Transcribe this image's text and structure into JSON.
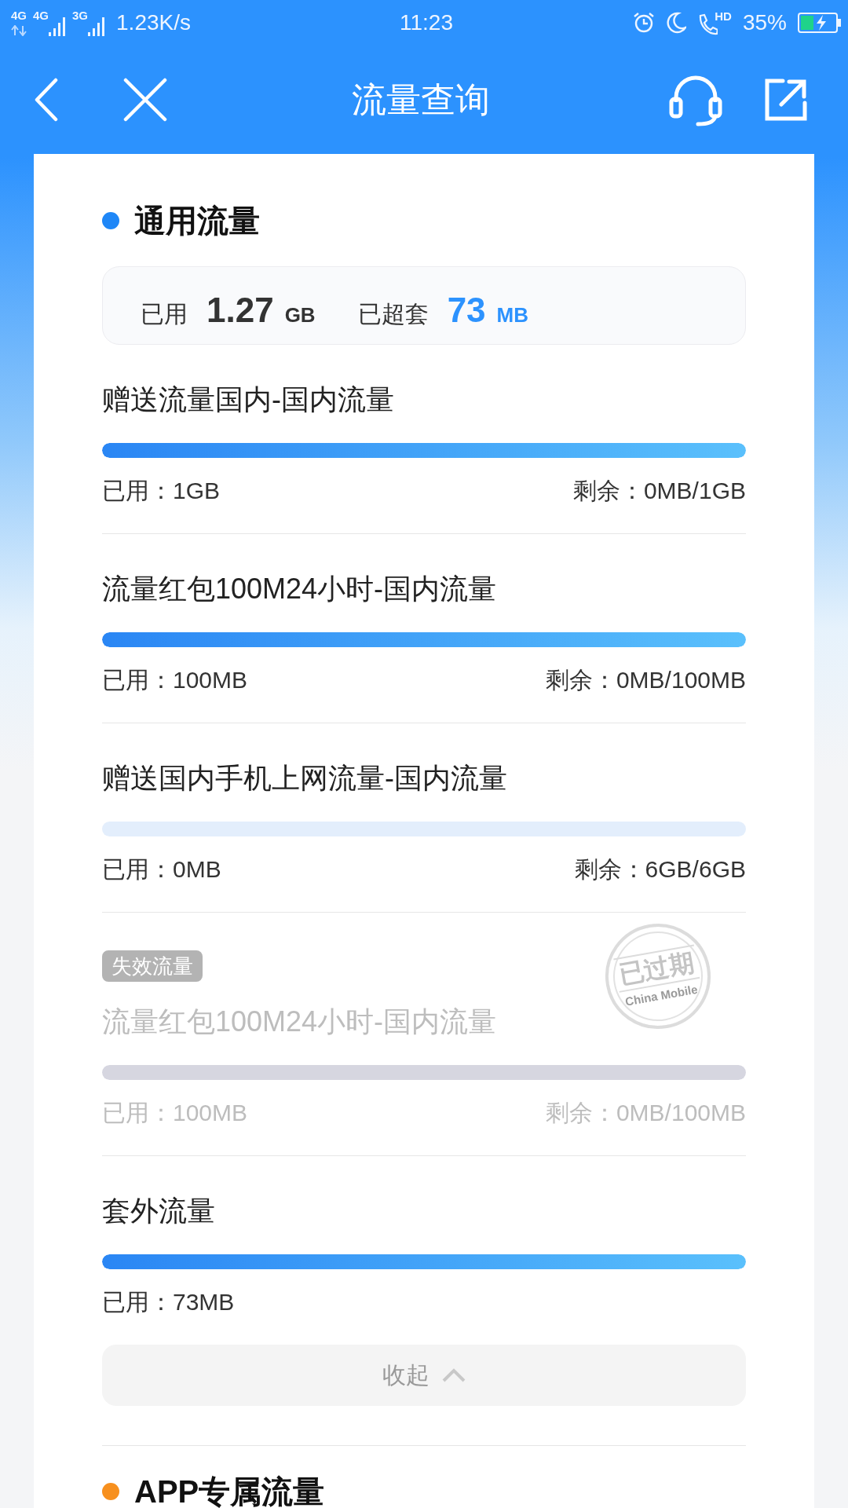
{
  "status_bar": {
    "networks": [
      {
        "label": "4G",
        "kind": "data"
      },
      {
        "label": "4G",
        "kind": "signal"
      },
      {
        "label": "3G",
        "kind": "signal"
      }
    ],
    "speed": "1.23K/s",
    "time": "11:23",
    "call_label": "HD",
    "battery": "35%"
  },
  "header": {
    "title": "流量查询"
  },
  "sections": [
    {
      "title": "通用流量",
      "color": "#1f87f7",
      "summary": {
        "used_label": "已用",
        "used_value": "1.27",
        "used_unit": "GB",
        "over_label": "已超套",
        "over_value": "73",
        "over_unit": "MB"
      },
      "items": [
        {
          "title": "赠送流量国内-国内流量",
          "expired": false,
          "level": 1,
          "used": "已用：1GB",
          "remaining": "剩余：0MB/1GB"
        },
        {
          "title": "流量红包100M24小时-国内流量",
          "expired": false,
          "level": 1,
          "used": "已用：100MB",
          "remaining": "剩余：0MB/100MB"
        },
        {
          "title": "赠送国内手机上网流量-国内流量",
          "expired": false,
          "level": 0,
          "used": "已用：0MB",
          "remaining": "剩余：6GB/6GB"
        },
        {
          "badge": "失效流量",
          "stamp": {
            "text": "已过期",
            "subtext": "China Mobile"
          },
          "title": "流量红包100M24小时-国内流量",
          "expired": true,
          "level": 1,
          "used": "已用：100MB",
          "remaining": "剩余：0MB/100MB"
        },
        {
          "title": "套外流量",
          "expired": false,
          "level": 1,
          "used": "已用：73MB"
        }
      ],
      "collapse": {
        "label": "收起"
      }
    },
    {
      "title": "APP专属流量",
      "color": "#f7901e"
    }
  ]
}
